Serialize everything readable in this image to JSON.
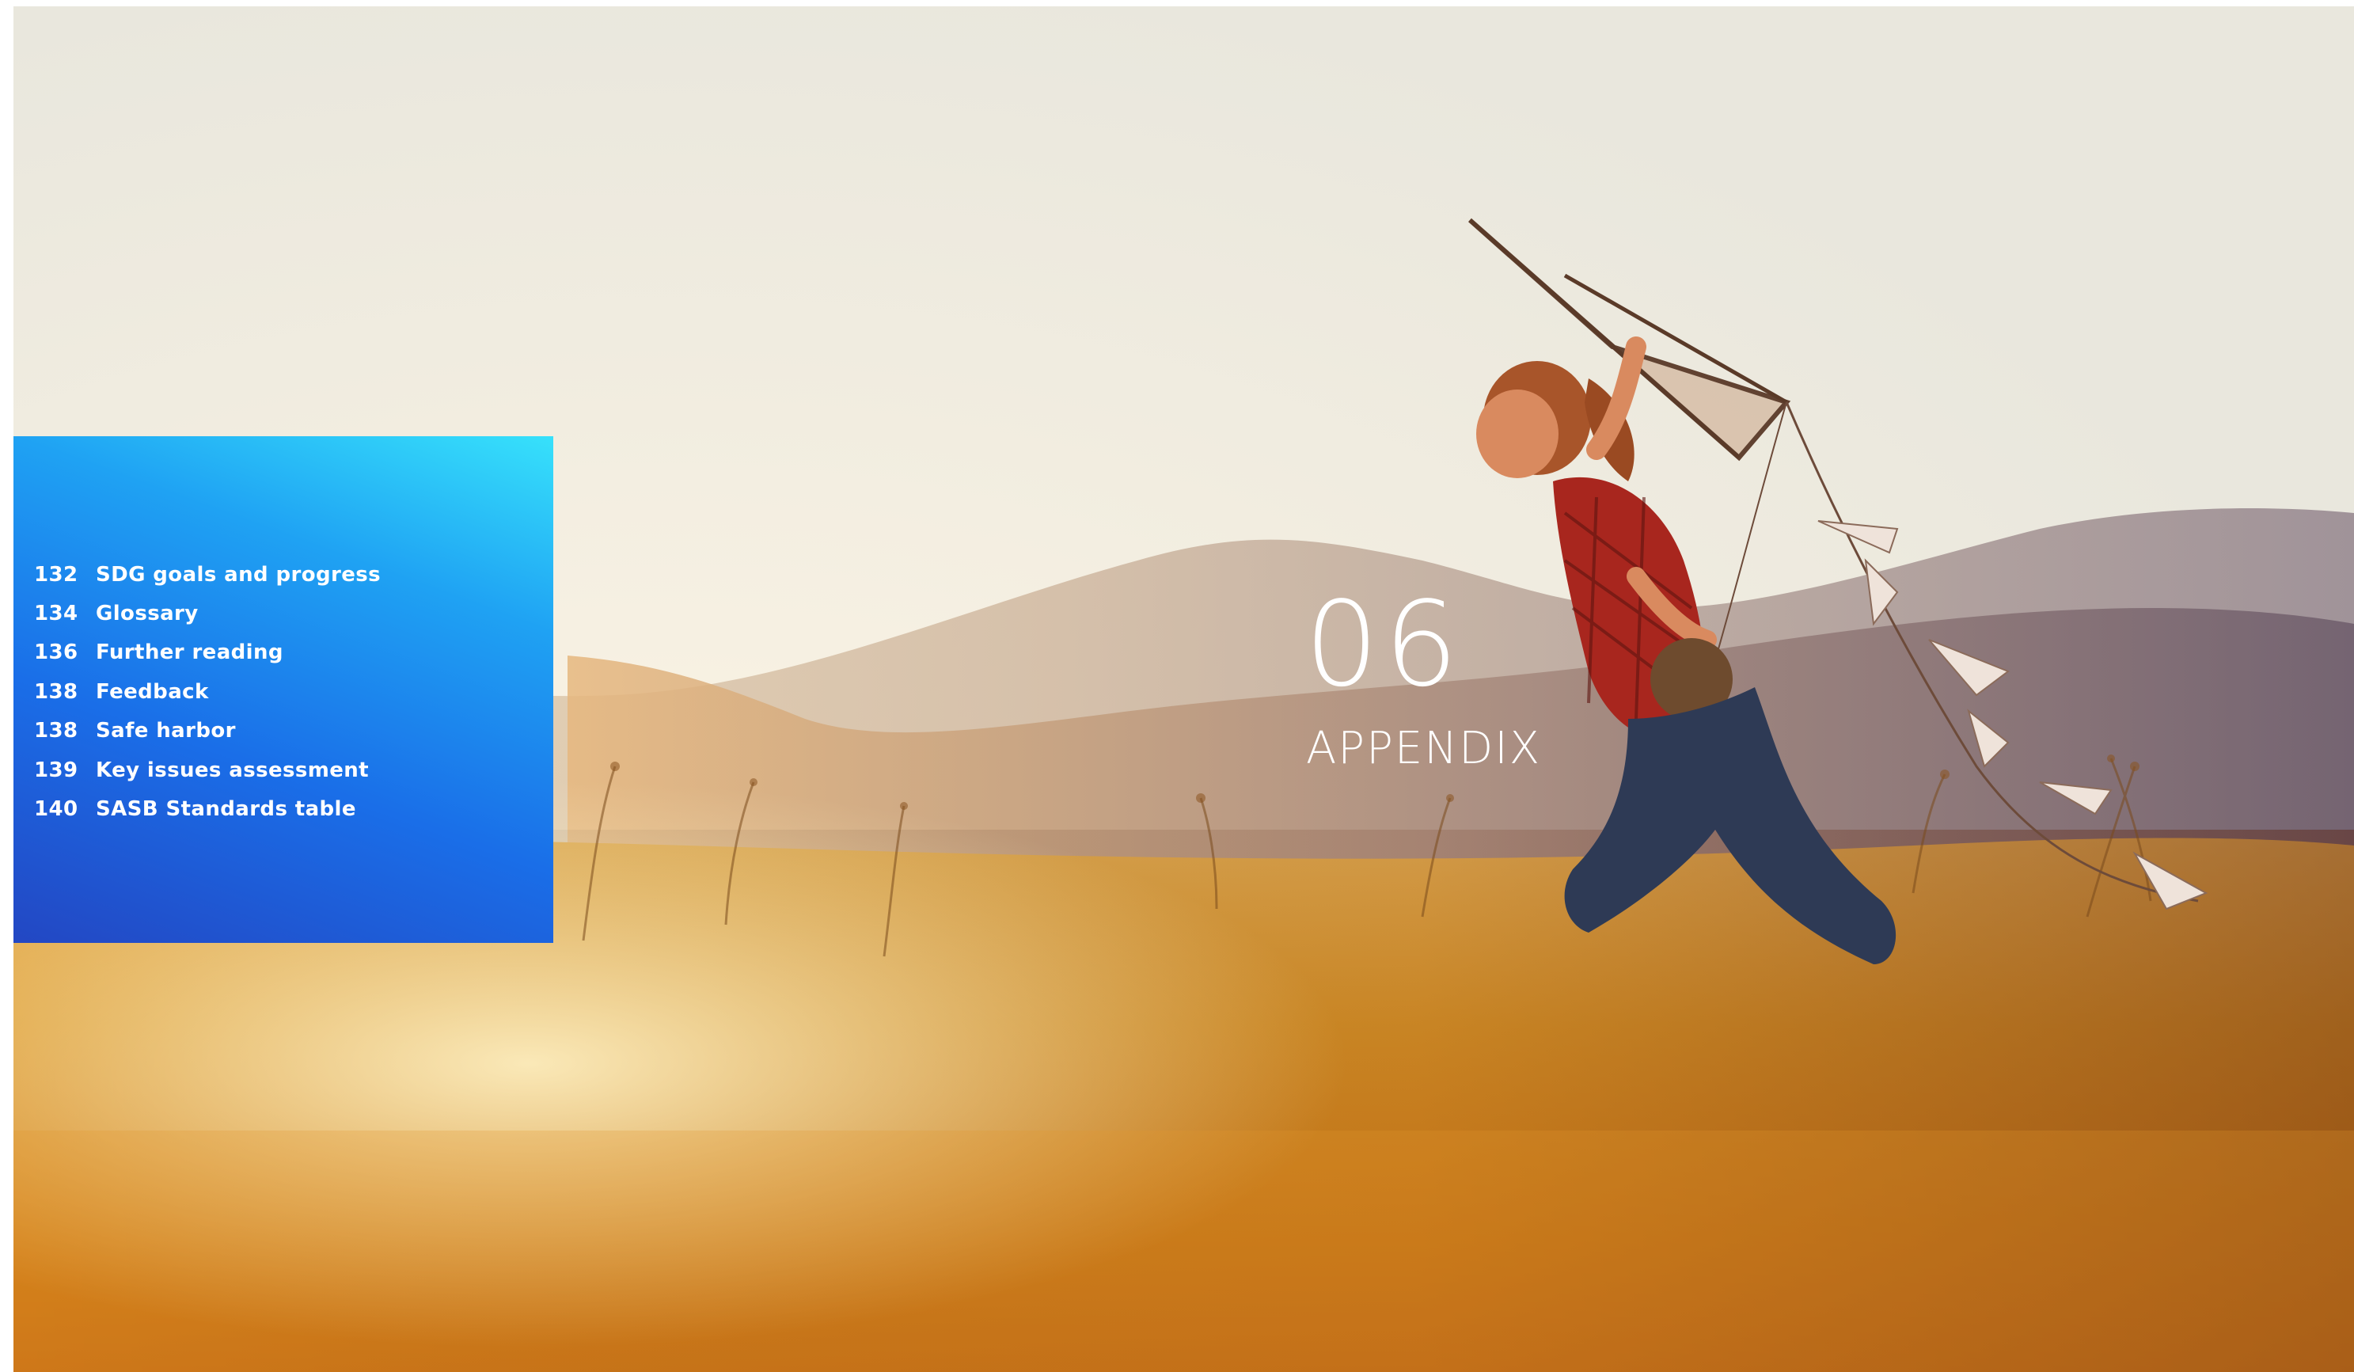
{
  "chapter": {
    "number": "06",
    "title": "APPENDIX"
  },
  "toc": [
    {
      "page": "132",
      "label": "SDG goals and progress"
    },
    {
      "page": "134",
      "label": "Glossary"
    },
    {
      "page": "136",
      "label": "Further reading"
    },
    {
      "page": "138",
      "label": "Feedback"
    },
    {
      "page": "138",
      "label": "Safe harbor"
    },
    {
      "page": "139",
      "label": "Key issues assessment"
    },
    {
      "page": "140",
      "label": "SASB Standards table"
    }
  ],
  "colors": {
    "panel_top": "#37e1fb",
    "panel_bottom": "#2347c3",
    "sky": "#f3eede",
    "field": "#d88a1e"
  }
}
